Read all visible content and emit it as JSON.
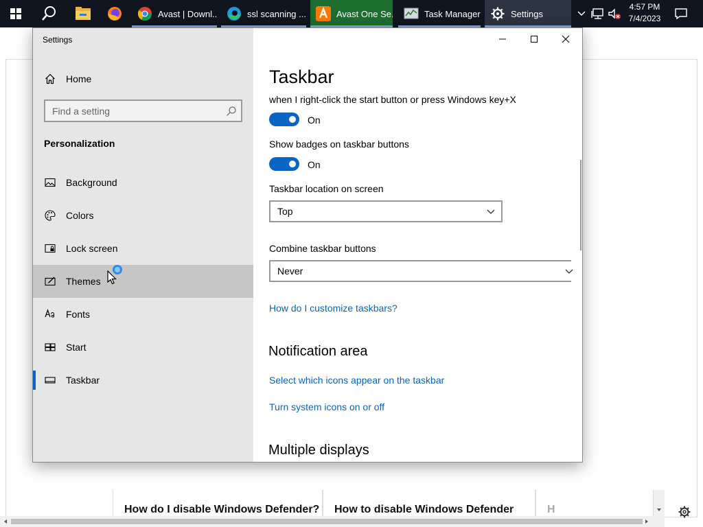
{
  "taskbar": {
    "apps": [
      {
        "label": "Avast | Downl...",
        "icon": "chrome-icon"
      },
      {
        "label": "ssl scanning ...",
        "icon": "edge-icon"
      },
      {
        "label": "Avast One Se...",
        "icon": "avast-icon"
      },
      {
        "label": "Task Manager",
        "icon": "task-manager-icon"
      },
      {
        "label": "Settings",
        "icon": "gear-icon"
      }
    ],
    "time": "4:57 PM",
    "date": "7/4/2023"
  },
  "background_page": {
    "articles": [
      "How do I disable Windows Defender?",
      "How to disable Windows Defender",
      "H"
    ]
  },
  "window": {
    "title": "Settings",
    "controls": {
      "minimize": "minimize",
      "maximize": "maximize",
      "close": "close"
    }
  },
  "sidebar": {
    "home": "Home",
    "search_placeholder": "Find a setting",
    "section": "Personalization",
    "items": [
      {
        "label": "Background",
        "icon": "picture-icon"
      },
      {
        "label": "Colors",
        "icon": "palette-icon"
      },
      {
        "label": "Lock screen",
        "icon": "lock-screen-icon"
      },
      {
        "label": "Themes",
        "icon": "themes-icon"
      },
      {
        "label": "Fonts",
        "icon": "fonts-icon"
      },
      {
        "label": "Start",
        "icon": "start-icon"
      },
      {
        "label": "Taskbar",
        "icon": "taskbar-icon"
      }
    ],
    "selected": "Taskbar",
    "hovered": "Themes"
  },
  "content": {
    "title": "Taskbar",
    "winx_text": "when I right-click the start button or press Windows key+X",
    "winx_toggle": "On",
    "badges_label": "Show badges on taskbar buttons",
    "badges_toggle": "On",
    "location_label": "Taskbar location on screen",
    "location_value": "Top",
    "combine_label": "Combine taskbar buttons",
    "combine_value": "Never",
    "customize_link": "How do I customize taskbars?",
    "notification_heading": "Notification area",
    "notif_link_icons": "Select which icons appear on the taskbar",
    "notif_link_system": "Turn system icons on or off",
    "multiple_displays_heading": "Multiple displays"
  },
  "colors": {
    "accent": "#0a64c4",
    "taskbar_bg": "#101520",
    "sidebar_bg": "#e6e6e6"
  }
}
